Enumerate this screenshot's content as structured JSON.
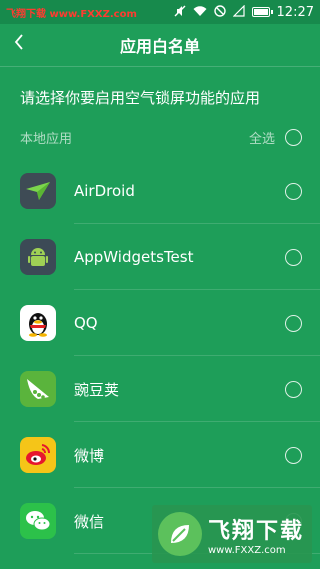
{
  "status": {
    "watermark": "飞翔下载 www.FXXZ.com",
    "time": "12:27"
  },
  "header": {
    "back_icon": "chevron-left-icon",
    "title": "应用白名单"
  },
  "description": "请选择你要启用空气锁屏功能的应用",
  "section": {
    "label": "本地应用",
    "select_all": "全选"
  },
  "apps": [
    {
      "name": "AirDroid",
      "icon": "airdroid-icon"
    },
    {
      "name": "AppWidgetsTest",
      "icon": "android-icon"
    },
    {
      "name": "QQ",
      "icon": "qq-penguin-icon"
    },
    {
      "name": "豌豆荚",
      "icon": "wandoujia-icon"
    },
    {
      "name": "微博",
      "icon": "weibo-icon"
    },
    {
      "name": "微信",
      "icon": "wechat-icon"
    }
  ],
  "watermark_logo": {
    "brand": "飞翔下载",
    "url": "www.FXXZ.com"
  },
  "colors": {
    "background": "#1e9e59",
    "statusbar": "#178a4c"
  }
}
